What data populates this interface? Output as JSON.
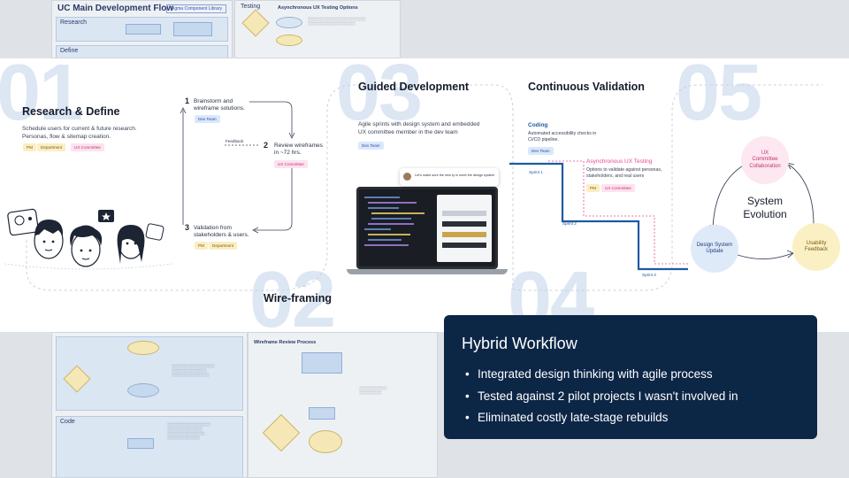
{
  "background": {
    "top_doc_title": "UC Main Development Flow",
    "top_doc_link": "Figma Component Library",
    "top_lane_1": "Research",
    "top_lane_2": "Define",
    "testing_label": "Testing",
    "testing_title": "Asynchronous UX Testing Options",
    "bottom_lane": "Code",
    "review_title": "Wireframe Review Process"
  },
  "stages": {
    "research": {
      "number": "01",
      "title": "Research & Define",
      "desc_line1": "Schedule users for current & future research.",
      "desc_line2": "Personas, flow & sitemap creation.",
      "tags": [
        "PM",
        "Department",
        "UX Committee"
      ]
    },
    "wireframing": {
      "number": "02",
      "title": "Wire-framing",
      "steps": [
        {
          "num": "1",
          "line1": "Brainstorm and",
          "line2": "wireframe solutions.",
          "tags": [
            "Dev Team"
          ]
        },
        {
          "num": "2",
          "line1": "Review wireframes",
          "line2": "in ~72 hrs.",
          "tags": [
            "UX Committee"
          ]
        },
        {
          "num": "3",
          "line1": "Validation from",
          "line2": "stakeholders & users.",
          "tags": [
            "PM",
            "Department"
          ]
        }
      ],
      "feedback_label": "Feedback"
    },
    "development": {
      "number": "03",
      "title": "Guided Development",
      "desc_line1": "Agile sprints with design system and embedded",
      "desc_line2": "UX committee member in the dev team",
      "tag": "Dev Team",
      "chat_text": "Let's make sure the new ty in meet the design system"
    },
    "validation": {
      "number": "04",
      "title": "Continuous Validation",
      "coding_title": "Coding",
      "coding_line1": "Automated accessibility checks in",
      "coding_line2": "CI/CD pipeline.",
      "coding_tag": "Dev Team",
      "testing_title": "Asynchronous UX Testing",
      "testing_line1": "Options to validate against personas,",
      "testing_line2": "stakeholders, and real users",
      "testing_tags": [
        "PM",
        "UX Committee"
      ],
      "sprints": [
        "Sprint 1",
        "Sprint 2",
        "Sprint 3"
      ]
    },
    "evolution": {
      "number": "05",
      "title_line1": "System",
      "title_line2": "Evolution",
      "nodes": {
        "committee": [
          "UX",
          "Committee",
          "Collaboration"
        ],
        "update": [
          "Design System",
          "Update"
        ],
        "feedback": [
          "Usability",
          "Feedback"
        ]
      }
    }
  },
  "summary": {
    "title": "Hybrid Workflow",
    "bullets": [
      "Integrated design thinking with agile process",
      "Tested against 2 pilot projects I wasn't involved in",
      "Eliminated costly late-stage rebuilds"
    ]
  },
  "colors": {
    "card_bg": "#0c2646",
    "sprint_line": "#1f5aa0",
    "pink_accent": "#e54b91",
    "big_number": "#dde6f3"
  }
}
